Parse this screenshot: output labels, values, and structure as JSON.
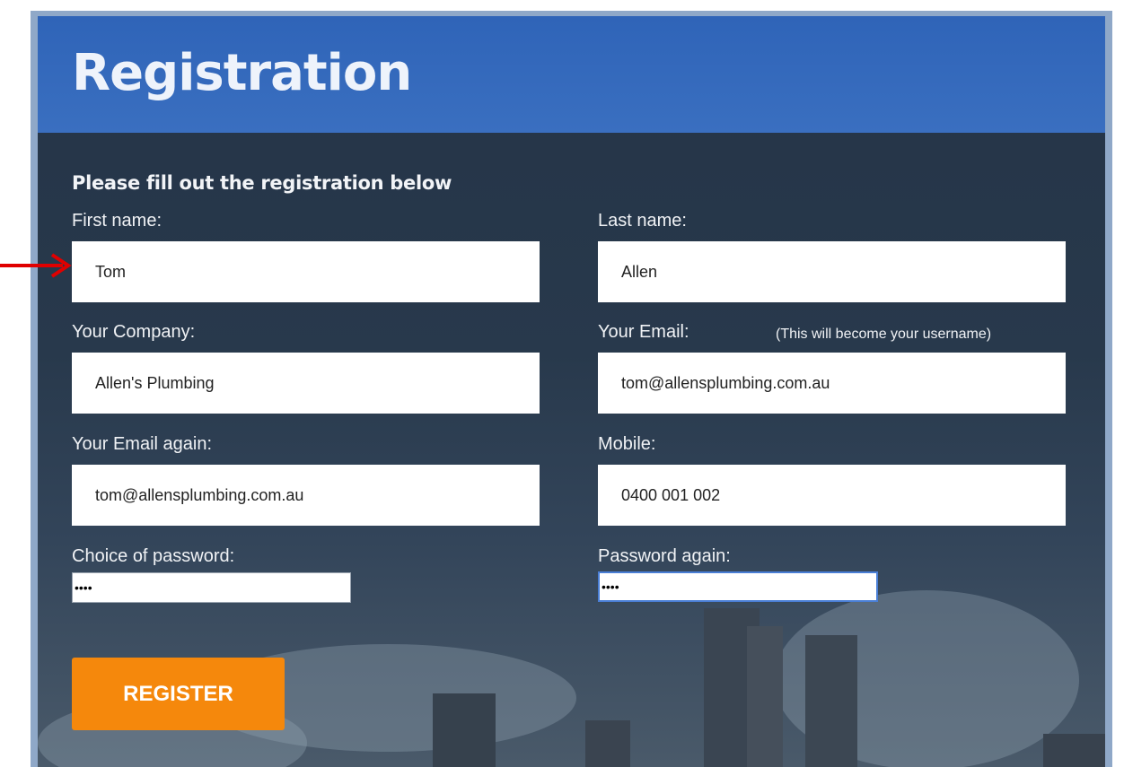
{
  "header": {
    "title": "Registration"
  },
  "form": {
    "subtitle": "Please fill out the registration below",
    "first_name": {
      "label": "First name:",
      "value": "Tom"
    },
    "last_name": {
      "label": "Last name:",
      "value": "Allen"
    },
    "company": {
      "label": "Your Company:",
      "value": "Allen's Plumbing"
    },
    "email": {
      "label": "Your Email:",
      "note": "(This will become your username)",
      "value": "tom@allensplumbing.com.au"
    },
    "email_again": {
      "label": "Your Email again:",
      "value": "tom@allensplumbing.com.au"
    },
    "mobile": {
      "label": "Mobile:",
      "value": "0400 001 002"
    },
    "password": {
      "label": "Choice of password:",
      "value": "••••"
    },
    "password_again": {
      "label": "Password again:",
      "value": "••••"
    },
    "register_label": "REGISTER"
  },
  "colors": {
    "header": "#3a6fc0",
    "panel": "#28394c",
    "register_button": "#f5880c",
    "arrow": "#e00000"
  },
  "icons": {
    "pointer": "red-arrow-icon"
  }
}
